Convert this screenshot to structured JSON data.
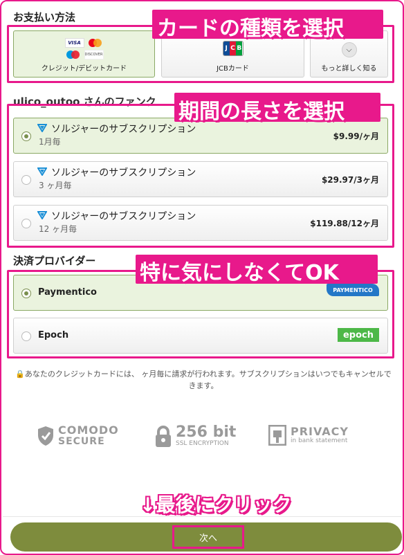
{
  "payment_method": {
    "title": "お支払い方法",
    "cards": [
      {
        "label": "クレジット/デビットカード",
        "selected": true
      },
      {
        "label": "JCBカード",
        "selected": false
      },
      {
        "label": "もっと詳しく知る",
        "selected": false
      }
    ],
    "logos": {
      "visa": "VISA",
      "discover": "DISCOVER",
      "jcb": [
        "J",
        "C",
        "B"
      ]
    }
  },
  "plans": {
    "title_partial": "ulico_outoo さんのファンク",
    "items": [
      {
        "name": "ソルジャーのサブスクリプション",
        "period": "1月毎",
        "price": "$9.99/ヶ月",
        "selected": true
      },
      {
        "name": "ソルジャーのサブスクリプション",
        "period": "3 ヶ月毎",
        "price": "$29.97/3ヶ月",
        "selected": false
      },
      {
        "name": "ソルジャーのサブスクリプション",
        "period": "12 ヶ月毎",
        "price": "$119.88/12ヶ月",
        "selected": false
      }
    ]
  },
  "providers": {
    "title": "決済プロバイダー",
    "items": [
      {
        "name": "Paymentico",
        "logo_text": "PAYMENTICO",
        "selected": true
      },
      {
        "name": "Epoch",
        "logo_text": "epoch",
        "selected": false
      }
    ]
  },
  "note": "🔒あなたのクレジットカードには、 ヶ月毎に請求が行われます。サブスクリプションはいつでもキャンセルできます。",
  "trust": {
    "comodo": {
      "line1": "COMODO",
      "line2": "SECURE"
    },
    "ssl": {
      "line1": "256 bit",
      "line2": "SSL ENCRYPTION"
    },
    "privacy": {
      "line1": "PRIVACY",
      "line2": "in bank statement"
    }
  },
  "next_button": "次へ",
  "annotations": {
    "card_type": "カードの種類を選択",
    "period": "期間の長さを選択",
    "provider": "特に気にしなくてOK",
    "click": "↓最後にクリック"
  },
  "colors": {
    "accent": "#e8198b",
    "selected_bg": "#eaf3de",
    "button": "#7e8c3d"
  }
}
